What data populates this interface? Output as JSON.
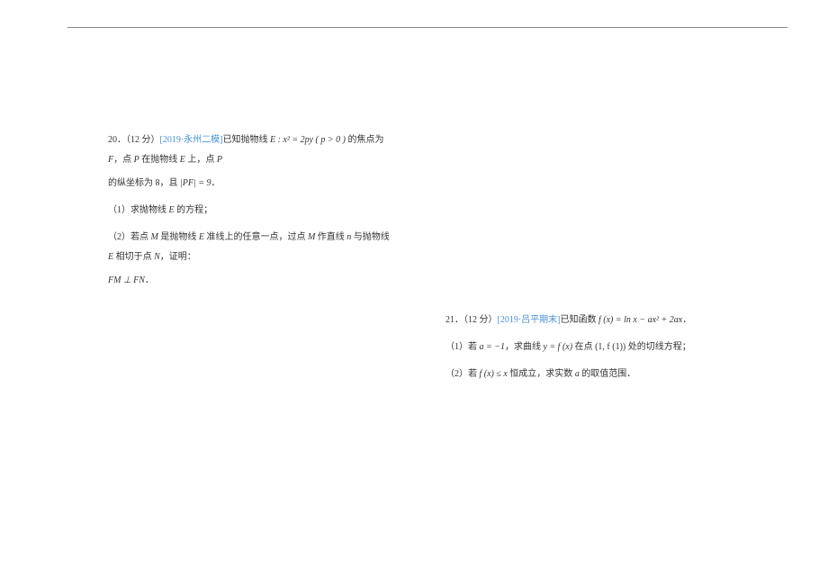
{
  "q20": {
    "num": "20．（12 分）",
    "source": "[2019·永州二模]",
    "intro_a": "已知抛物线 ",
    "curve_eq": "E : x² = 2py ( p > 0 )",
    "intro_b": " 的焦点为 ",
    "focus": "F",
    "intro_c": "，点 ",
    "point_p": "P",
    "intro_d": " 在抛物线 ",
    "curve_e": "E",
    "intro_e": " 上，点 ",
    "intro_f": "",
    "line2_a": "的纵坐标为 8，且 ",
    "pf_eq": "|PF| = 9",
    "line2_b": "．",
    "part1": "（1）求抛物线 ",
    "part1_e": "E",
    "part1_end": " 的方程；",
    "part2_a": "（2）若点 ",
    "part2_m": "M",
    "part2_b": " 是抛物线 ",
    "part2_e": "E",
    "part2_c": " 准线上的任意一点，过点 ",
    "part2_m2": "M",
    "part2_d": " 作直线 ",
    "part2_n": "n",
    "part2_e2": " 与抛物线 ",
    "part2_e3": "E",
    "part2_f": " 相切于点 ",
    "part2_n2": "N",
    "part2_g": "，证明：",
    "part2_conclusion": "FM ⊥ FN",
    "part2_end": "．"
  },
  "q21": {
    "num": "21．（12 分）",
    "source": "[2019·吕平期末]",
    "intro_a": "已知函数 ",
    "func_eq": "f (x) = ln x − ax² + 2ax",
    "intro_end": "．",
    "part1_a": "（1）若 ",
    "part1_cond": "a = −1",
    "part1_b": "，求曲线 ",
    "part1_curve": "y = f (x)",
    "part1_c": " 在点 ",
    "part1_point": "(1, f (1))",
    "part1_d": " 处的切线方程；",
    "part2_a": "（2）若 ",
    "part2_cond": "f (x) ≤ x",
    "part2_b": " 恒成立，求实数 ",
    "part2_var": "a",
    "part2_c": " 的取值范围．"
  }
}
